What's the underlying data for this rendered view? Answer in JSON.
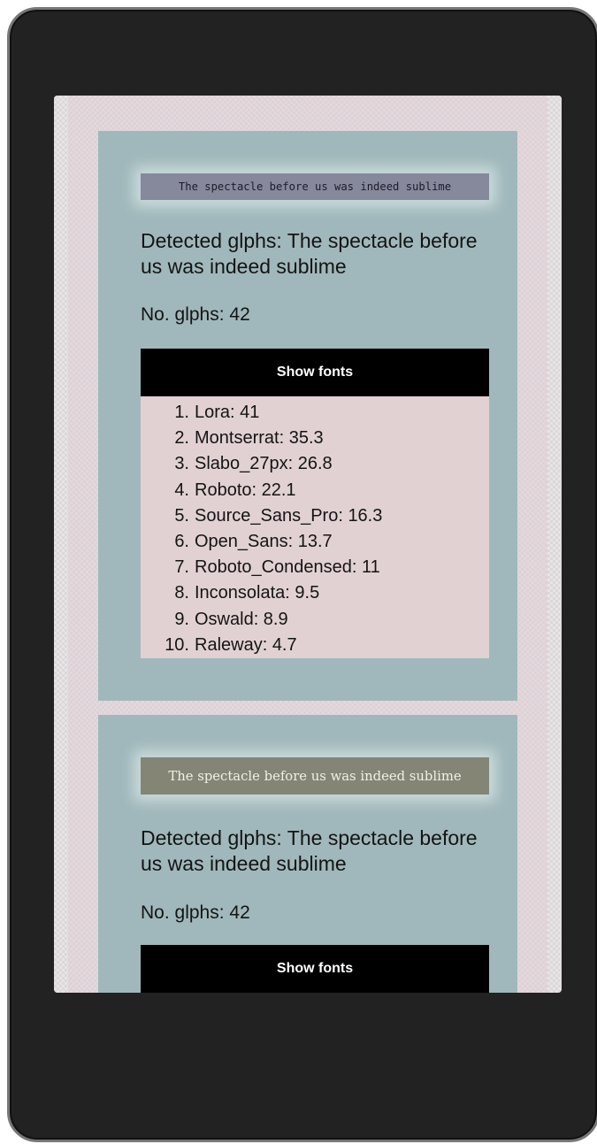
{
  "results": [
    {
      "sample_text": "The spectacle before us was indeed sublime",
      "detected": "Detected glphs: The spectacle before us was indeed sublime",
      "count": "No. glphs: 42",
      "button_label": "Show fonts",
      "fonts": [
        {
          "num": "1.",
          "label": "Lora: 41"
        },
        {
          "num": "2.",
          "label": "Montserrat: 35.3"
        },
        {
          "num": "3.",
          "label": "Slabo_27px: 26.8"
        },
        {
          "num": "4.",
          "label": "Roboto: 22.1"
        },
        {
          "num": "5.",
          "label": "Source_Sans_Pro: 16.3"
        },
        {
          "num": "6.",
          "label": "Open_Sans: 13.7"
        },
        {
          "num": "7.",
          "label": "Roboto_Condensed: 11"
        },
        {
          "num": "8.",
          "label": "Inconsolata: 9.5"
        },
        {
          "num": "9.",
          "label": "Oswald: 8.9"
        },
        {
          "num": "10.",
          "label": "Raleway: 4.7"
        }
      ]
    },
    {
      "sample_text": "The spectacle before us was indeed sublime",
      "detected": "Detected glphs: The spectacle before us was indeed sublime",
      "count": "No. glphs: 42",
      "button_label": "Show fonts"
    }
  ],
  "colors": {
    "card_bg": "#a0b8bb",
    "list_bg": "#e2d1d3",
    "button_bg": "#000000",
    "phone_frame": "#222222"
  }
}
